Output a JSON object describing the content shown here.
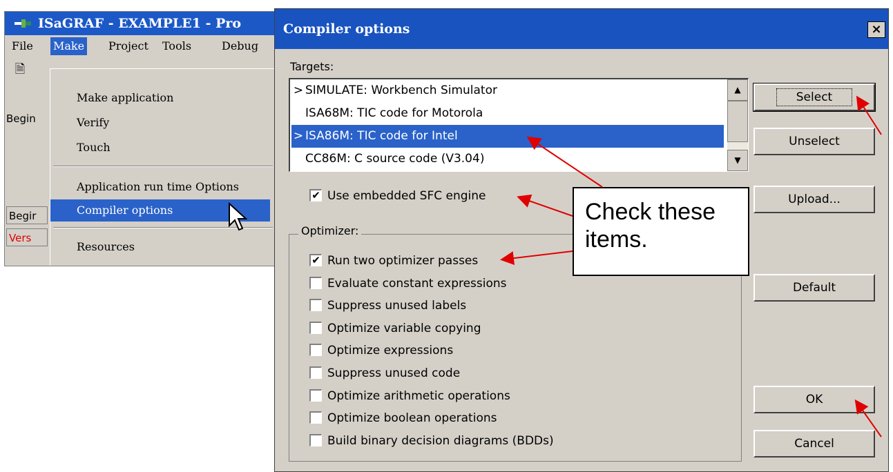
{
  "background_window": {
    "title": "ISaGRAF - EXAMPLE1 - Pro",
    "menubar": [
      "File",
      "Make",
      "Project",
      "Tools",
      "Debug"
    ],
    "left_text": {
      "begin1": "Begin",
      "begin2": "Begir",
      "version": "Vers"
    }
  },
  "make_menu": {
    "items": [
      "Make application",
      "Verify",
      "Touch",
      "Application run time Options",
      "Compiler options",
      "Resources"
    ]
  },
  "dialog": {
    "title": "Compiler options",
    "close_label": "×",
    "targets_label": "Targets:",
    "targets": [
      {
        "label": "SIMULATE: Workbench Simulator",
        "mark": ">"
      },
      {
        "label": "ISA68M: TIC code for Motorola",
        "mark": ""
      },
      {
        "label": "ISA86M: TIC code for Intel",
        "mark": ">"
      },
      {
        "label": "CC86M: C source code (V3.04)",
        "mark": ""
      }
    ],
    "use_sfc_label": "Use embedded SFC engine",
    "use_sfc_checked": true,
    "optimizer_label": "Optimizer:",
    "optimizer_options": [
      {
        "label": "Run two optimizer passes",
        "checked": true
      },
      {
        "label": "Evaluate constant expressions",
        "checked": false
      },
      {
        "label": "Suppress unused labels",
        "checked": false
      },
      {
        "label": "Optimize variable copying",
        "checked": false
      },
      {
        "label": "Optimize expressions",
        "checked": false
      },
      {
        "label": "Suppress unused code",
        "checked": false
      },
      {
        "label": "Optimize arithmetic operations",
        "checked": false
      },
      {
        "label": "Optimize boolean operations",
        "checked": false
      },
      {
        "label": "Build binary decision diagrams (BDDs)",
        "checked": false
      }
    ],
    "buttons": {
      "select": "Select",
      "unselect": "Unselect",
      "upload": "Upload...",
      "default": "Default",
      "ok": "OK",
      "cancel": "Cancel"
    }
  },
  "callout": {
    "line1": "Check these",
    "line2": "items."
  },
  "colors": {
    "title_blue": "#1853c0",
    "highlight": "#2a62c9",
    "dialog_face": "#d4d0c8",
    "arrow": "#e00000"
  }
}
